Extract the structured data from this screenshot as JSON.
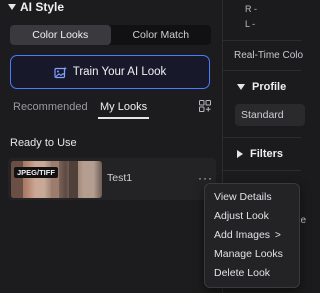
{
  "section": {
    "title": "AI Style"
  },
  "segment": {
    "options": [
      "Color Looks",
      "Color Match"
    ],
    "selected": "Color Looks"
  },
  "train_button": {
    "label": "Train Your AI Look"
  },
  "tabs": {
    "items": [
      "Recommended",
      "My Looks"
    ],
    "active": "My Looks"
  },
  "ready": {
    "label": "Ready to Use"
  },
  "look": {
    "badge": "JPEG/TIFF",
    "name": "Test1",
    "more": "···"
  },
  "right": {
    "r_label": "R -",
    "l_label": "L -",
    "realtime": "Real-Time Colo",
    "profile": {
      "title": "Profile",
      "value": "Standard"
    },
    "filters": {
      "title": "Filters"
    },
    "partial": "nce"
  },
  "menu": {
    "items": [
      "View Details",
      "Adjust Look",
      "Add Images",
      "Manage Looks",
      "Delete Look"
    ],
    "submenu_chevron": ">"
  },
  "colors": {
    "accent": "#4a7cff",
    "panel": "#1c1c1e",
    "menu_bg": "#232326"
  }
}
